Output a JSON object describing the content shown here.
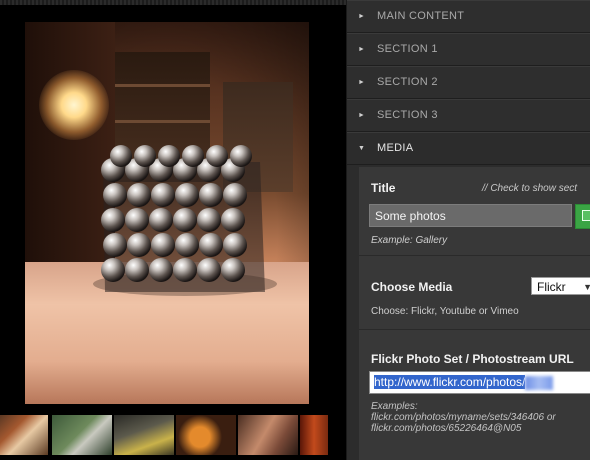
{
  "sections": [
    {
      "label": "MAIN CONTENT",
      "expanded": false
    },
    {
      "label": "SECTION 1",
      "expanded": false
    },
    {
      "label": "SECTION 2",
      "expanded": false
    },
    {
      "label": "SECTION 3",
      "expanded": false
    },
    {
      "label": "MEDIA",
      "expanded": true
    }
  ],
  "icons": {
    "collapsed": "triangle-right-icon",
    "expanded": "triangle-down-icon",
    "checkbox": "checkbox-icon",
    "select_arrow": "chevron-down-icon"
  },
  "media": {
    "title_label": "Title",
    "check_note": "// Check to show sect",
    "title_value": "Some photos",
    "title_example": "Example: Gallery",
    "choose_label": "Choose Media",
    "choose_selected": "Flickr",
    "choose_hint": "Choose: Flickr, Youtube or Vimeo",
    "url_label": "Flickr Photo Set / Photostream URL",
    "url_value": "http://www.flickr.com/photos/",
    "examples_label": "Examples:",
    "example_1": "flickr.com/photos/myname/sets/346406 or",
    "example_2": "flickr.com/photos/65226464@N05"
  },
  "colors": {
    "panel_bg": "#2c2c2c",
    "media_bg": "#383838",
    "accent_green": "#3aa544",
    "selection_blue": "#3366cc"
  },
  "thumbnails_count": 6
}
